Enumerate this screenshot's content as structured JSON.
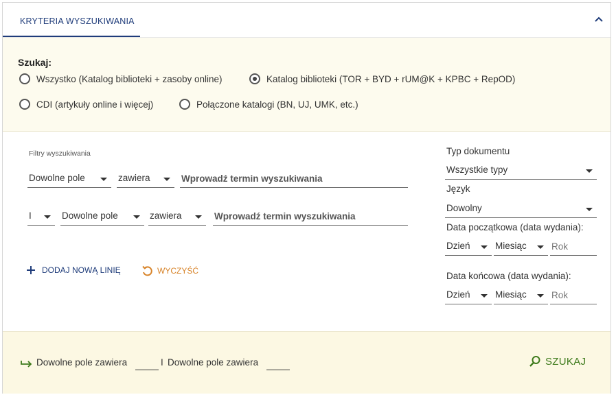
{
  "header": {
    "tab_label": "KRYTERIA WYSZUKIWANIA"
  },
  "search_scope": {
    "label": "Szukaj:",
    "options": [
      {
        "label": "Wszystko (Katalog biblioteki + zasoby online)",
        "selected": false
      },
      {
        "label": "Katalog biblioteki (TOR + BYD + rUM@K + KPBC + RepOD)",
        "selected": true
      },
      {
        "label": "CDI (artykuły online i więcej)",
        "selected": false
      },
      {
        "label": "Połączone katalogi (BN, UJ, UMK, etc.)",
        "selected": false
      }
    ]
  },
  "filters": {
    "title": "Filtry wyszukiwania",
    "rows": [
      {
        "field": "Dowolne pole",
        "operator": "zawiera",
        "placeholder": "Wprowadź termin wyszukiwania"
      },
      {
        "boolean": "I",
        "field": "Dowolne pole",
        "operator": "zawiera",
        "placeholder": "Wprowadź termin wyszukiwania"
      }
    ],
    "add_line_label": "DODAJ NOWĄ LINIĘ",
    "clear_label": "WYCZYŚĆ"
  },
  "right_panel": {
    "doc_type_label": "Typ dokumentu",
    "doc_type_value": "Wszystkie typy",
    "language_label": "Język",
    "language_value": "Dowolny",
    "start_date_label": "Data początkowa (data wydania):",
    "end_date_label": "Data końcowa (data wydania):",
    "day_value": "Dzień",
    "month_value": "Miesiąc",
    "year_placeholder": "Rok"
  },
  "footer": {
    "summary_part1": "Dowolne pole  zawiera",
    "summary_bool": "I",
    "summary_part2": "Dowolne pole  zawiera",
    "search_button": "SZUKAJ"
  },
  "colors": {
    "accent_blue": "#1f3c7a",
    "orange": "#d8842a",
    "green": "#3d7a1b",
    "cream": "#fcf8e3"
  }
}
